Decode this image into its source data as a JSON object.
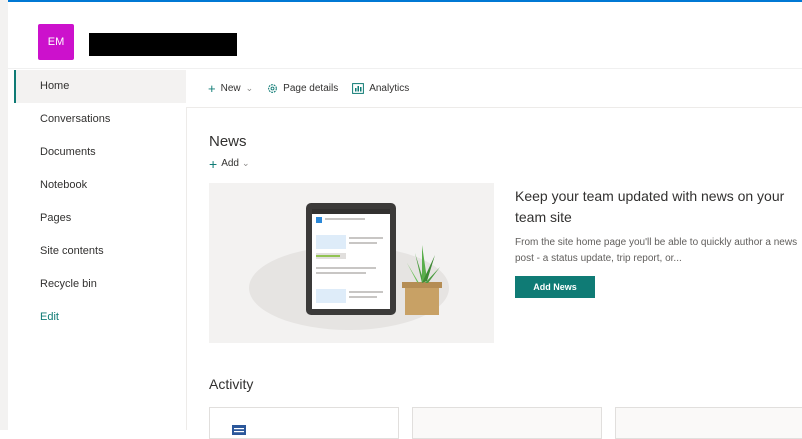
{
  "colors": {
    "accent": "#0f7b75",
    "logo_bg": "#cc11cc",
    "top_accent": "#0078d4"
  },
  "site": {
    "logo_initials": "EM"
  },
  "leftnav": {
    "items": [
      {
        "label": "Home",
        "selected": true
      },
      {
        "label": "Conversations"
      },
      {
        "label": "Documents"
      },
      {
        "label": "Notebook"
      },
      {
        "label": "Pages"
      },
      {
        "label": "Site contents"
      },
      {
        "label": "Recycle bin"
      }
    ],
    "edit_label": "Edit"
  },
  "commandbar": {
    "new_label": "New",
    "page_details_label": "Page details",
    "analytics_label": "Analytics"
  },
  "news": {
    "title": "News",
    "add_label": "Add",
    "heading": "Keep your team updated with news on your team site",
    "description": "From the site home page you'll be able to quickly author a news post - a status update, trip report, or...",
    "button_label": "Add News"
  },
  "activity": {
    "title": "Activity"
  }
}
